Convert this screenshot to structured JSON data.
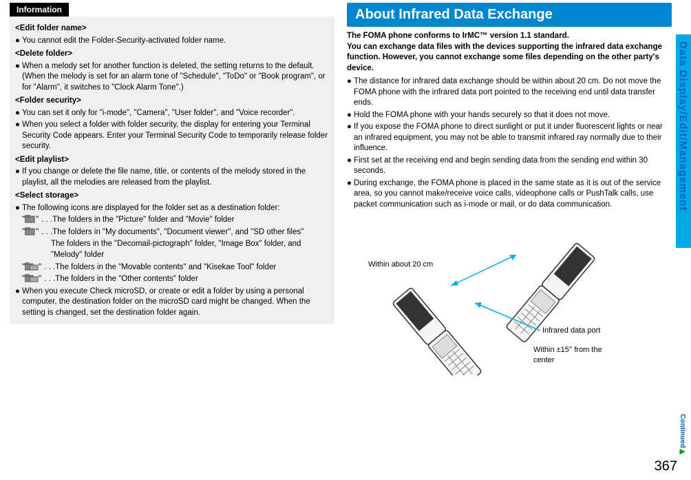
{
  "left": {
    "infoTab": "Information",
    "h1": "<Edit folder name>",
    "b1": "You cannot edit the Folder-Security-activated folder name.",
    "h2": "<Delete folder>",
    "b2": "When a melody set for another function is deleted, the setting returns to the default. (When the melody is set for an alarm tone of \"Schedule\", \"ToDo\" or \"Book program\", or for \"Alarm\", it switches to \"Clock Alarm Tone\".)",
    "h3": "<Folder security>",
    "b3a": "You can set it only for \"i-mode\", \"Camera\", \"User folder\", and \"Voice recorder\".",
    "b3b": "When you select a folder with folder security, the display for entering your Terminal Security Code appears. Enter your Terminal Security Code to temporarily release folder security.",
    "h4": "<Edit playlist>",
    "b4": "If you change or delete the file name, title, or contents of the melody stored in the playlist, all the melodies are released from the playlist.",
    "h5": "<Select storage>",
    "b5intro": "The following icons are displayed for the folder set as a destination folder:",
    "icon1": ". . .The folders in the \"Picture\" folder and \"Movie\" folder",
    "icon2a": ". . .The folders in \"My documents\", \"Document viewer\", and \"SD other files\"",
    "icon2b": "The folders in the \"Decomail-pictograph\" folder, \"Image Box\" folder, and \"Melody\" folder",
    "icon3": ". . .The folders in the \"Movable contents\" and \"Kisekae Tool\" folder",
    "icon4": ". . .The folders in the \"Other contents\" folder",
    "b5end": "When you execute Check microSD, or create or edit a folder by using a personal computer, the destination folder on the microSD card might be changed. When the setting is changed, set the destination folder again."
  },
  "right": {
    "title": "About Infrared Data Exchange",
    "boldIntro": "The FOMA phone conforms to IrMC™ version 1.1 standard.\nYou can exchange data files with the devices supporting the infrared data exchange function. However, you cannot exchange some files depending on the other party's device.",
    "r1": "The distance for infrared data exchange should be within about 20 cm. Do not move the FOMA phone with the infrared data port pointed to the receiving end until data transfer ends.",
    "r2": "Hold the FOMA phone with your hands securely so that it does not move.",
    "r3": "If you expose the FOMA phone to direct sunlight or put it under fluorescent lights or near an infrared equipment, you may not be able to transmit infrared ray normally due to their influence.",
    "r4": "First set at the receiving end and begin sending data from the sending end within 30 seconds.",
    "r5": "During exchange, the FOMA phone is placed in the same state as it is out of the service area, so you cannot make/receive voice calls, videophone calls or PushTalk calls, use packet communication such as i-mode or mail, or do data communication.",
    "d_label1": "Within about 20 cm",
    "d_label2": "Infrared data port",
    "d_label3": "Within ±15° from the center"
  },
  "sideTab": "Data Display/Edit/Management",
  "continued": "Continued",
  "pageNum": "367"
}
